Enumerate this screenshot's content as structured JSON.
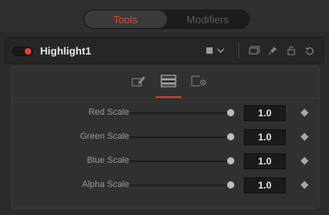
{
  "tabs": {
    "tools": "Tools",
    "modifiers": "Modifiers"
  },
  "tool": {
    "name": "Highlight1"
  },
  "colors": {
    "accent": "#e0452f",
    "enabled_dot": "#e8402a"
  },
  "controls": [
    {
      "label": "Red Scale",
      "value": "1.0",
      "slider_fraction": 1.0
    },
    {
      "label": "Green Scale",
      "value": "1.0",
      "slider_fraction": 1.0
    },
    {
      "label": "Blue Scale",
      "value": "1.0",
      "slider_fraction": 1.0
    },
    {
      "label": "Alpha Scale",
      "value": "1.0",
      "slider_fraction": 1.0
    }
  ]
}
